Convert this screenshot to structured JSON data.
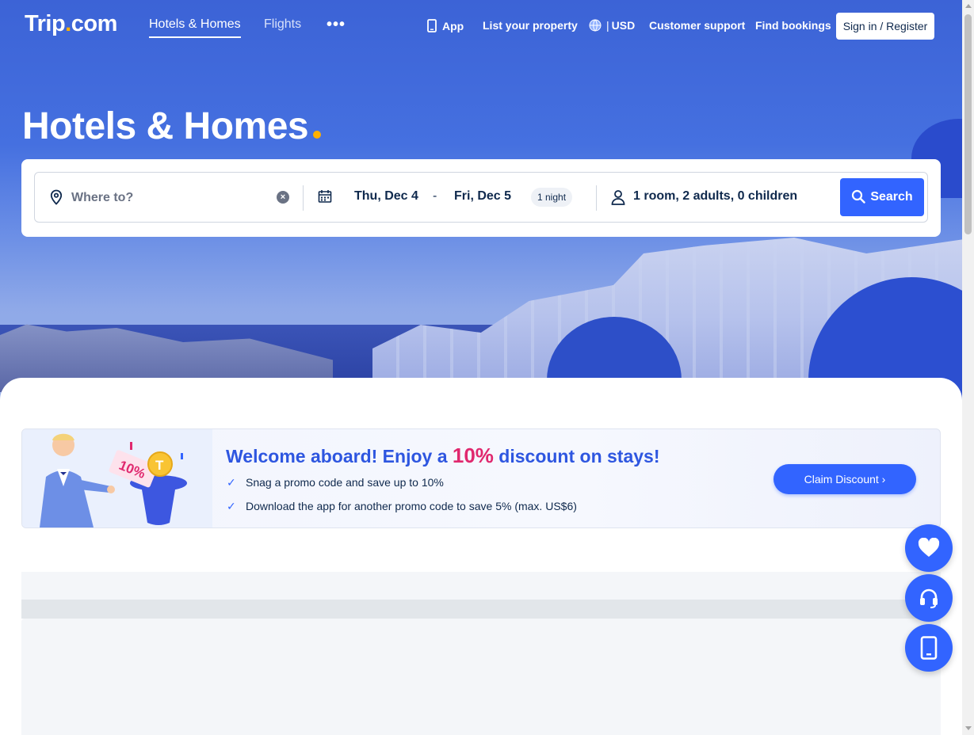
{
  "nav": {
    "logo_text": "Trip",
    "logo_dot": ".",
    "logo_suffix": "com",
    "tabs": [
      {
        "label": "Hotels & Homes",
        "active": true
      },
      {
        "label": "Flights",
        "active": false
      }
    ],
    "more_label": "•••",
    "app_label": "App",
    "list_property_label": "List your property",
    "currency_label": "USD",
    "currency_sep": "|",
    "support_label": "Customer support",
    "bookings_label": "Find bookings",
    "signin_label": "Sign in / Register"
  },
  "hero": {
    "title": "Hotels & Homes"
  },
  "search": {
    "destination_placeholder": "Where to?",
    "destination_value": "",
    "checkin": "Thu, Dec 4",
    "date_separator": "-",
    "checkout": "Fri, Dec 5",
    "nights": "1 night",
    "guests": "1 room, 2 adults, 0 children",
    "button_label": "Search"
  },
  "promo": {
    "title_prefix": "Welcome aboard! Enjoy a ",
    "title_percent": "10%",
    "title_suffix": " discount on stays!",
    "items": [
      "Snag a promo code and save up to 10%",
      "Download the app for another promo code to save 5% (max. US$6)"
    ],
    "button_label": "Claim Discount ›",
    "illustration_text": "10%"
  },
  "colors": {
    "brand_blue": "#3264ff",
    "logo_dot": "#ffb000",
    "promo_title": "#2e56e0",
    "promo_percent": "#e0286e"
  },
  "floating": {
    "icons": [
      "heart-icon",
      "headset-icon",
      "mobile-icon"
    ]
  }
}
